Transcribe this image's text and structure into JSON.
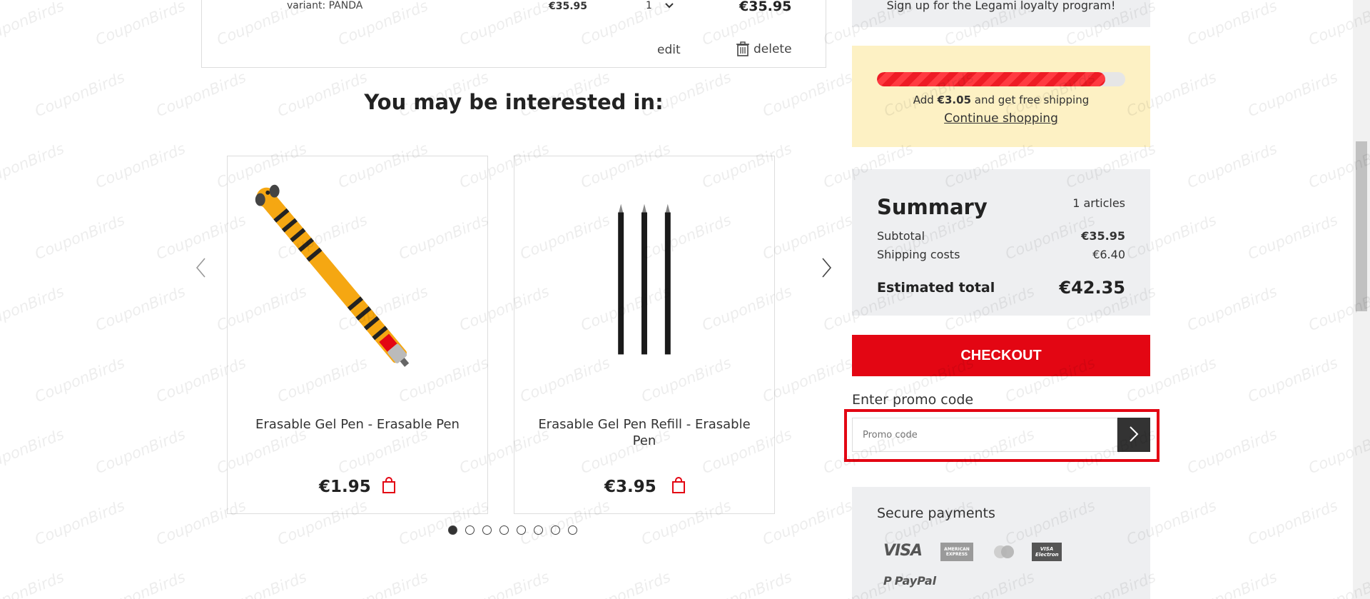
{
  "cart_item": {
    "variant": "variant: PANDA",
    "unit_price": "€35.95",
    "quantity": "1",
    "line_total": "€35.95",
    "edit_label": "edit",
    "delete_label": "delete"
  },
  "recommendations": {
    "title": "You may be interested in:",
    "products": [
      {
        "name": "Erasable Gel Pen - Erasable Pen",
        "price": "€1.95"
      },
      {
        "name": "Erasable Gel Pen Refill - Erasable Pen",
        "price": "€3.95"
      }
    ],
    "carousel_pages": 8,
    "active_page": 1
  },
  "loyalty": {
    "text": "Sign up for the Legami loyalty program!"
  },
  "shipping": {
    "progress_percent": 92,
    "msg_prefix": "Add",
    "amount": "€3.05",
    "msg_suffix": "and get free shipping",
    "continue_label": "Continue shopping"
  },
  "summary": {
    "title": "Summary",
    "count": "1 articles",
    "subtotal_label": "Subtotal",
    "subtotal_value": "€35.95",
    "shipping_label": "Shipping costs",
    "shipping_value": "€6.40",
    "total_label": "Estimated total",
    "total_value": "€42.35"
  },
  "checkout": {
    "label": "CHECKOUT"
  },
  "promo": {
    "label": "Enter promo code",
    "placeholder": "Promo code"
  },
  "payments": {
    "title": "Secure payments",
    "methods": [
      "visa-icon",
      "american-express-icon",
      "mastercard-icon",
      "visa-electron-icon",
      "paypal-icon"
    ],
    "visa_text": "VISA",
    "amex_text": "AMERICAN EXPRESS",
    "visa_electron_text": "VISA Electron",
    "paypal_text": "PayPal"
  },
  "watermark": {
    "text": "CouponBirds"
  },
  "colors": {
    "accent_red": "#e30613",
    "shipping_bg": "#fdf1c4",
    "panel_bg": "#eeeff1"
  }
}
